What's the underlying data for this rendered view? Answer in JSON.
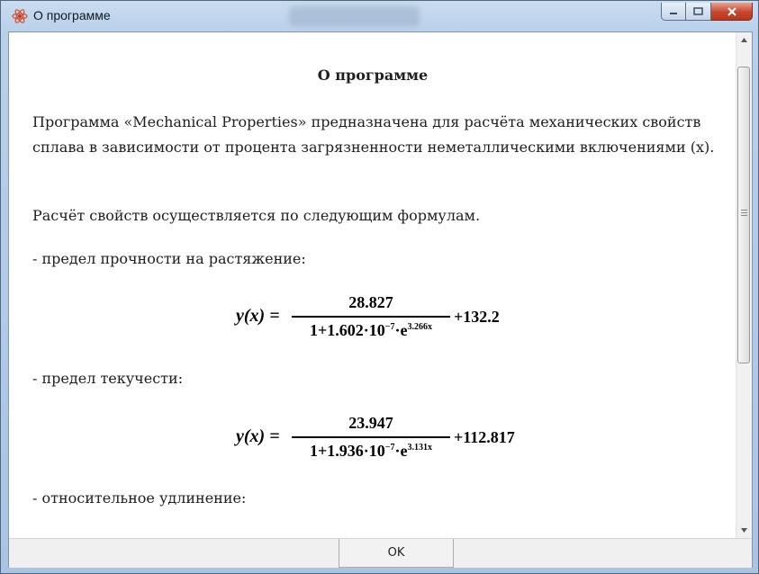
{
  "window": {
    "title": "О программе",
    "icons": {
      "app": "atom-icon",
      "minimize": "minimize-icon",
      "maximize": "maximize-icon",
      "close": "close-icon"
    }
  },
  "content": {
    "heading": "О программе",
    "intro": "Программа «Mechanical Properties» предназначена для расчёта механических свойств сплава в зависимости от процента загрязненности неметаллическими включениями (x).",
    "calc_line": "Расчёт свойств осуществляется по следующим формулам.",
    "sections": [
      {
        "label": "- предел прочности на растяжение:",
        "formula": {
          "lhs": "y(x) =",
          "numerator": "28.827",
          "den_base": "1+1.602·10",
          "den_exp1": "−7",
          "den_mid": "·e",
          "den_exp2": "3.266x",
          "plus": "+132.2"
        }
      },
      {
        "label": "- предел текучести:",
        "formula": {
          "lhs": "y(x) =",
          "numerator": "23.947",
          "den_base": "1+1.936·10",
          "den_exp1": "−7",
          "den_mid": "·e",
          "den_exp2": "3.131x",
          "plus": "+112.817"
        }
      },
      {
        "label": "- относительное удлинение:"
      }
    ]
  },
  "footer": {
    "ok_label": "OK"
  },
  "scrollbar": {
    "thumb": "scroll-thumb"
  }
}
